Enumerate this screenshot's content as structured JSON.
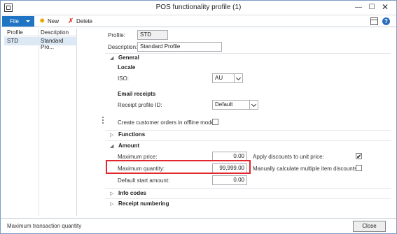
{
  "window": {
    "title": "POS functionality profile (1)",
    "minimize_glyph": "—",
    "maximize_glyph": "☐",
    "close_glyph": "✕"
  },
  "toolbar": {
    "file_label": "File",
    "new_label": "New",
    "delete_label": "Delete",
    "new_icon": "✹",
    "delete_icon": "✗",
    "help_glyph": "?"
  },
  "list": {
    "columns": [
      "Profile",
      "Description"
    ],
    "rows": [
      {
        "profile": "STD",
        "description": "Standard Pro..."
      }
    ]
  },
  "header_fields": {
    "profile_label": "Profile:",
    "profile_value": "STD",
    "description_label": "Description:",
    "description_value": "Standard Profile"
  },
  "sections": {
    "general": {
      "title": "General",
      "expanded": true,
      "locale_header": "Locale",
      "iso_label": "ISO:",
      "iso_value": "AU",
      "email_header": "Email receipts",
      "receipt_profile_label": "Receipt profile ID:",
      "receipt_profile_value": "Default",
      "offline_orders_label": "Create customer orders in offline mode:",
      "offline_orders_checked": false
    },
    "functions": {
      "title": "Functions",
      "expanded": false
    },
    "amount": {
      "title": "Amount",
      "expanded": true,
      "max_price_label": "Maximum price:",
      "max_price_value": "0.00",
      "max_quantity_label": "Maximum quantity:",
      "max_quantity_value": "99,999.00",
      "default_start_label": "Default start amount:",
      "default_start_value": "0.00",
      "apply_discounts_label": "Apply discounts to unit price:",
      "apply_discounts_checked": true,
      "manual_discounts_label": "Manually calculate multiple item discounts:",
      "manual_discounts_checked": false
    },
    "info_codes": {
      "title": "Info codes",
      "expanded": false
    },
    "receipt_numbering": {
      "title": "Receipt numbering",
      "expanded": false
    }
  },
  "glyphs": {
    "expanded": "◢",
    "collapsed": "▷",
    "check": "✔"
  },
  "status": {
    "text": "Maximum transaction quantity",
    "close_label": "Close"
  },
  "colors": {
    "accent": "#1f74c4",
    "highlight": "#e0272f",
    "selected_row": "#dde8f5"
  }
}
